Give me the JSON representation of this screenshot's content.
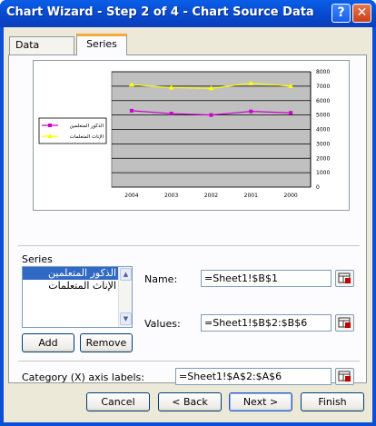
{
  "window": {
    "title": "Chart Wizard - Step 2 of 4 - Chart Source Data",
    "help_button": "?",
    "close_button": "✕"
  },
  "tabs": [
    {
      "label": "Data Range",
      "active": false
    },
    {
      "label": "Series",
      "active": true
    }
  ],
  "chart_data": {
    "type": "line",
    "categories": [
      "2004",
      "2003",
      "2002",
      "2001",
      "2000"
    ],
    "series": [
      {
        "name": "الذكور المتعلمين",
        "values": [
          5300,
          5100,
          5000,
          5250,
          5150
        ],
        "color": "#cc00cc",
        "marker": "square"
      },
      {
        "name": "الإناث المتعلمات",
        "values": [
          7100,
          6900,
          6850,
          7200,
          7000
        ],
        "color": "#ffff00",
        "marker": "triangle"
      }
    ],
    "y_ticks": [
      "0",
      "1000",
      "2000",
      "3000",
      "4000",
      "5000",
      "6000",
      "7000",
      "8000"
    ],
    "ylim": [
      0,
      8000
    ],
    "y_axis_side": "right",
    "legend_position": "left",
    "plot_background": "#c0c0c0",
    "grid": true
  },
  "series_section": {
    "label": "Series",
    "items": [
      {
        "label": "الذكور المتعلمين",
        "selected": true
      },
      {
        "label": "الإناث المتعلمات",
        "selected": false
      }
    ],
    "add_label": "Add",
    "remove_label": "Remove"
  },
  "fields": {
    "name_label": "Name:",
    "name_value": "=Sheet1!$B$1",
    "values_label": "Values:",
    "values_value": "=Sheet1!$B$2:$B$6",
    "category_label": "Category (X) axis labels:",
    "category_value": "=Sheet1!$A$2:$A$6"
  },
  "buttons": {
    "cancel": "Cancel",
    "back": "< Back",
    "next": "Next >",
    "finish": "Finish"
  }
}
